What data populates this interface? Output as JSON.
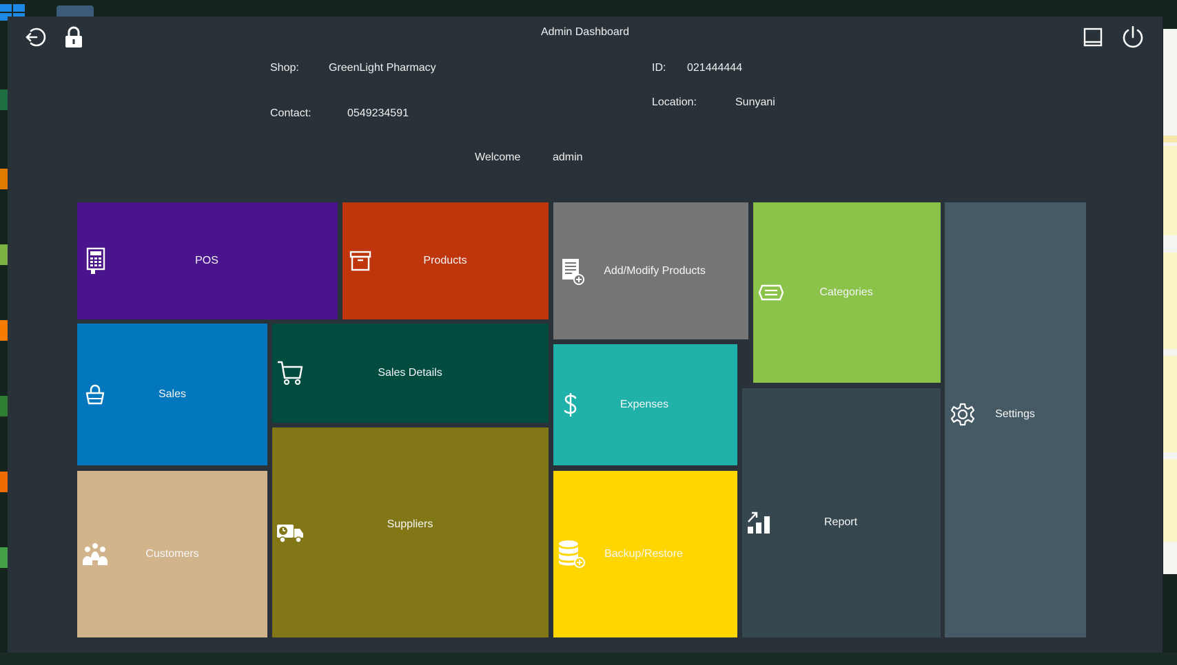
{
  "window": {
    "title": "Admin Dashboard",
    "background": "#283238"
  },
  "toolbar": {
    "logout_icon": "logout-icon",
    "lock_icon": "lock-icon",
    "minimize_icon": "minimize-icon",
    "power_icon": "power-icon"
  },
  "shop": {
    "shop_label": "Shop:",
    "shop_value": "GreenLight Pharmacy",
    "id_label": "ID:",
    "id_value": "021444444",
    "contact_label": "Contact:",
    "contact_value": "0549234591",
    "location_label": "Location:",
    "location_value": "Sunyani",
    "welcome_label": "Welcome",
    "welcome_user": "admin"
  },
  "tiles": {
    "pos": {
      "label": "POS",
      "icon": "calculator-icon",
      "color": "#4a148c"
    },
    "products": {
      "label": "Products",
      "icon": "archive-box-icon",
      "color": "#bf360c"
    },
    "add_modify": {
      "label": "Add/Modify Products",
      "icon": "document-add-icon",
      "color": "#757575"
    },
    "categories": {
      "label": "Categories",
      "icon": "tag-icon",
      "color": "#8bc34a"
    },
    "settings": {
      "label": "Settings",
      "icon": "gear-icon",
      "color": "#455a64"
    },
    "sales": {
      "label": "Sales",
      "icon": "shopping-bag-icon",
      "color": "#0277bd"
    },
    "sales_details": {
      "label": "Sales Details",
      "icon": "cart-icon",
      "color": "#004d40"
    },
    "expenses": {
      "label": "Expenses",
      "icon": "dollar-icon",
      "color": "#20b2aa"
    },
    "report": {
      "label": "Report",
      "icon": "chart-icon",
      "color": "#37474f"
    },
    "customers": {
      "label": "Customers",
      "icon": "people-icon",
      "color": "#d2b48c"
    },
    "suppliers": {
      "label": "Suppliers",
      "icon": "delivery-truck-icon",
      "color": "#827717"
    },
    "backup": {
      "label": "Backup/Restore",
      "icon": "database-add-icon",
      "color": "#ffd600"
    }
  }
}
